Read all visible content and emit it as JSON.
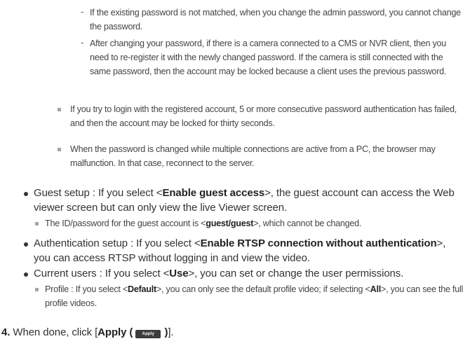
{
  "notes_sub": [
    "If the existing password is not matched, when you change the admin password, you cannot change the password.",
    "After changing your password, if there is a camera connected to a CMS or NVR client, then you need to re-register it with the newly changed password. If the camera is still connected with the same password, then the account may be locked because a client uses the previous password."
  ],
  "notes": [
    "If you try to login with the registered account, 5 or more consecutive password authentication has failed, and then the account may be locked for thirty seconds.",
    "When the password is changed while multiple connections are active from a PC, the browser may malfunction. In that case, reconnect to the server."
  ],
  "guest": {
    "prefix": "Guest setup : If you select <",
    "option": "Enable guest access",
    "suffix": ">, the guest account can access the Web viewer screen but can only view the live Viewer screen.",
    "note_prefix": "The ID/password for the guest account is <",
    "note_value": "guest/guest",
    "note_suffix": ">, which cannot be changed."
  },
  "auth": {
    "prefix": "Authentication setup : If you select <",
    "option": "Enable RTSP connection without authentication",
    "suffix": ">, you can access RTSP without logging in and view the video."
  },
  "users": {
    "prefix": "Current users : If you select <",
    "option": "Use",
    "suffix": ">, you can set or change the user permissions.",
    "note_prefix": "Profile : If you select <",
    "note_option1": "Default",
    "note_mid": ">, you can only see the default profile video; if selecting <",
    "note_option2": "All",
    "note_suffix": ">, you can see the full profile videos."
  },
  "step": {
    "number": "4.",
    "prefix": "When done, click [",
    "button_label": "Apply (",
    "chip_label": "Apply",
    "close": ")",
    "suffix": "]."
  }
}
